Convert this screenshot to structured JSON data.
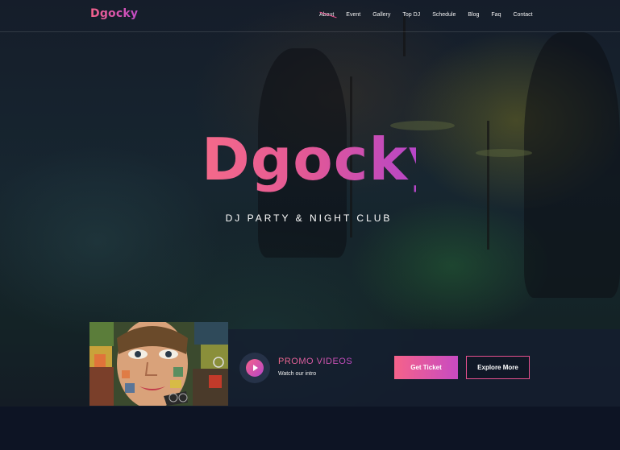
{
  "brand": {
    "logo": "Dgocky",
    "gradient_start": "#f2628a",
    "gradient_end": "#c24bc7"
  },
  "nav": {
    "items": [
      {
        "label": "About",
        "active": true
      },
      {
        "label": "Event",
        "active": false
      },
      {
        "label": "Gallery",
        "active": false
      },
      {
        "label": "Top DJ",
        "active": false
      },
      {
        "label": "Schedule",
        "active": false
      },
      {
        "label": "Blog",
        "active": false
      },
      {
        "label": "Faq",
        "active": false
      },
      {
        "label": "Contact",
        "active": false
      }
    ]
  },
  "hero": {
    "title": "Dgocky",
    "subtitle": "DJ PARTY & NIGHT CLUB"
  },
  "promo": {
    "image": "graffiti-portrait",
    "play_icon": "play-icon",
    "title": "PROMO VIDEOS",
    "subtitle": "Watch our intro",
    "get_ticket": "Get Ticket",
    "explore_more": "Explore More",
    "accent": "#e6508e"
  }
}
